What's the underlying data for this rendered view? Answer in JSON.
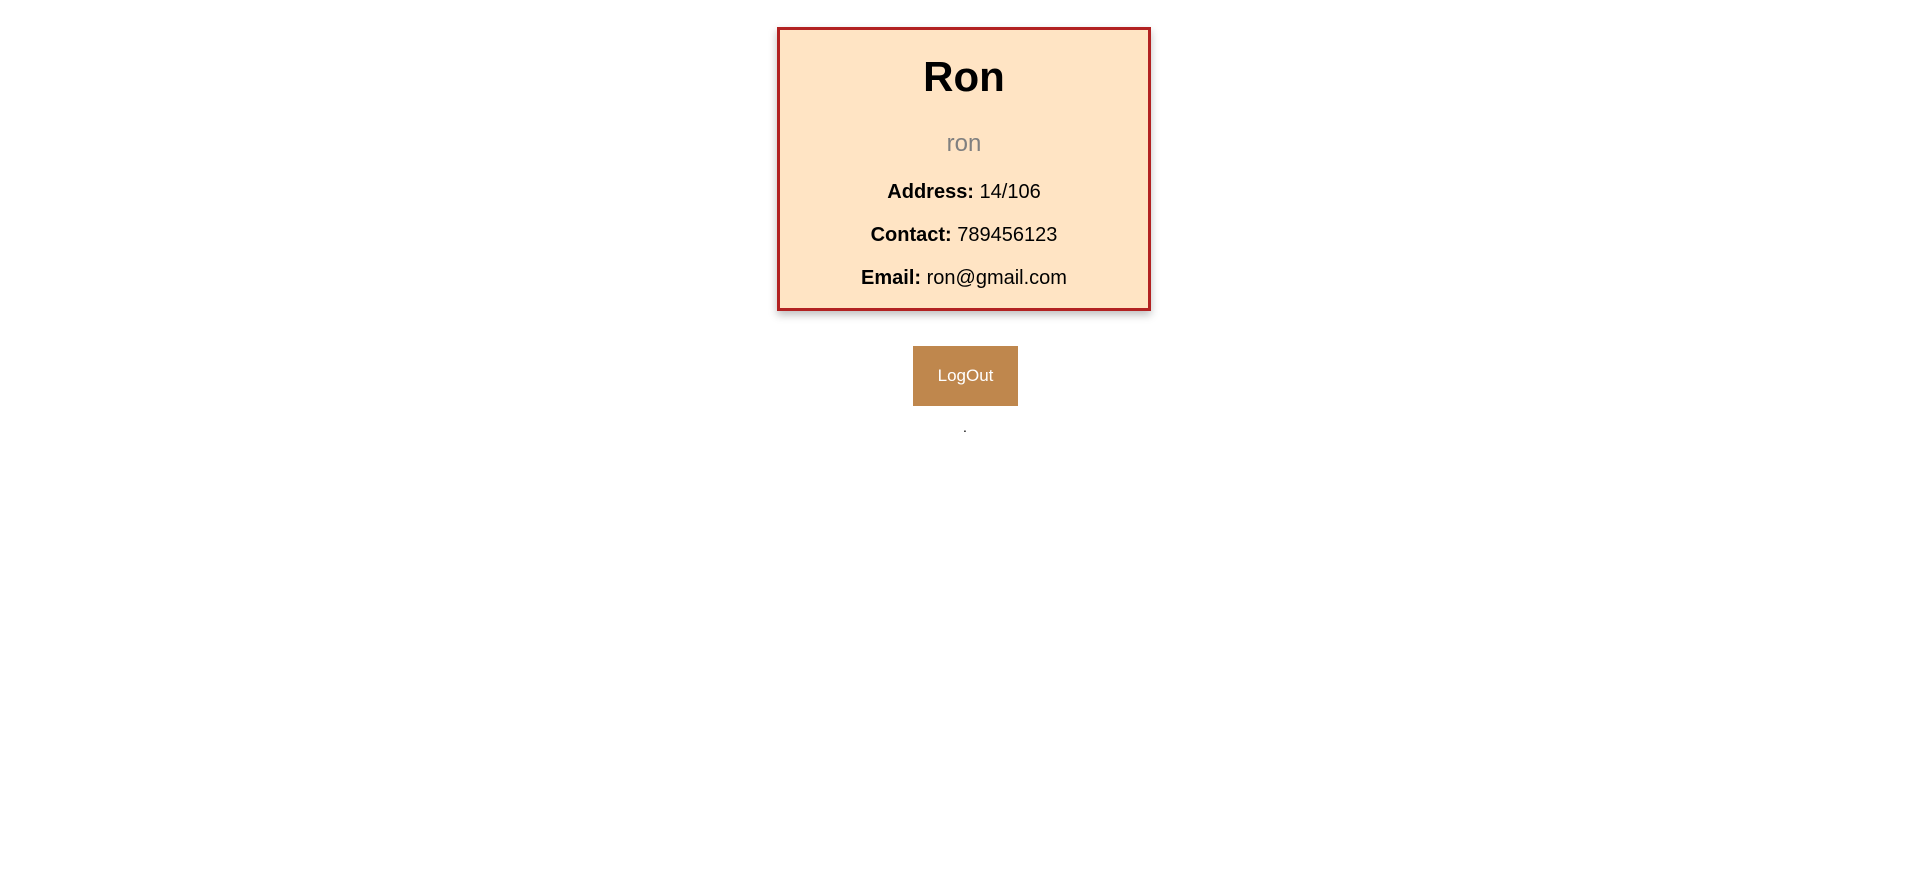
{
  "profile": {
    "name": "Ron",
    "username": "ron",
    "address_label": "Address:",
    "address_value": "14/106",
    "contact_label": "Contact:",
    "contact_value": "789456123",
    "email_label": "Email:",
    "email_value": "ron@gmail.com"
  },
  "actions": {
    "logout_label": "LogOut"
  },
  "footer": {
    "text": "."
  },
  "colors": {
    "card_background": "#ffe4c4",
    "card_border": "#b22222",
    "button_background": "#bf874d",
    "username_text": "#808080"
  }
}
